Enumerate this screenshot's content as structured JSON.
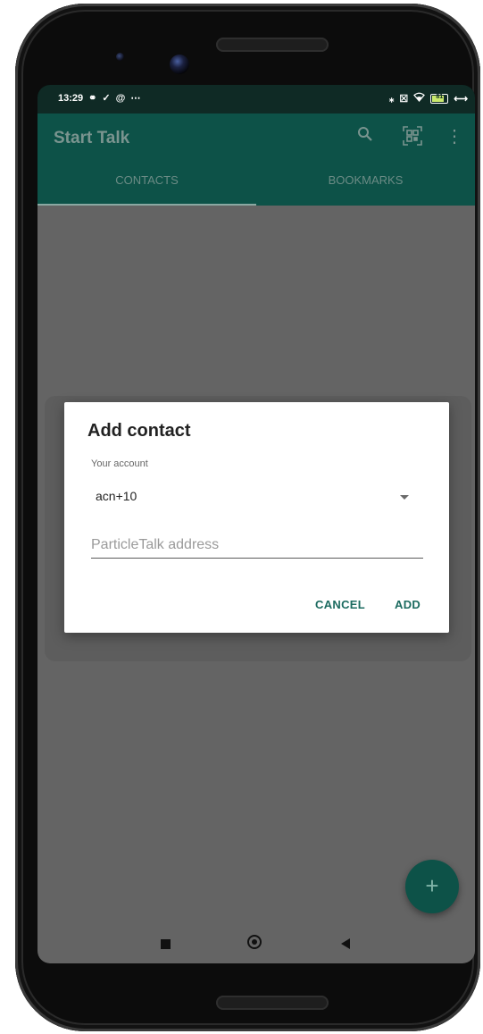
{
  "status_bar": {
    "time": "13:29",
    "left_icons": [
      "link-icon",
      "download-done-icon",
      "at-icon",
      "more-dots-icon"
    ],
    "right_icons": [
      "bluetooth-icon",
      "sim-icon",
      "wifi-icon",
      "battery-icon",
      "charging-icon"
    ],
    "battery_level": "81"
  },
  "app_bar": {
    "title": "Start Talk",
    "actions": [
      "search-icon",
      "qr-code-icon",
      "overflow-menu-icon"
    ]
  },
  "tabs": [
    {
      "label": "CONTACTS",
      "active": true
    },
    {
      "label": "BOOKMARKS",
      "active": false
    }
  ],
  "dialog": {
    "title": "Add contact",
    "account_label": "Your account",
    "account_value": "acn+10",
    "address_placeholder": "ParticleTalk address",
    "address_value": "",
    "cancel_label": "CANCEL",
    "add_label": "ADD"
  },
  "fab": {
    "symbol": "+"
  },
  "colors": {
    "primary": "#0d5248",
    "accent_text": "#1c6b60",
    "scrim": "#646464"
  }
}
